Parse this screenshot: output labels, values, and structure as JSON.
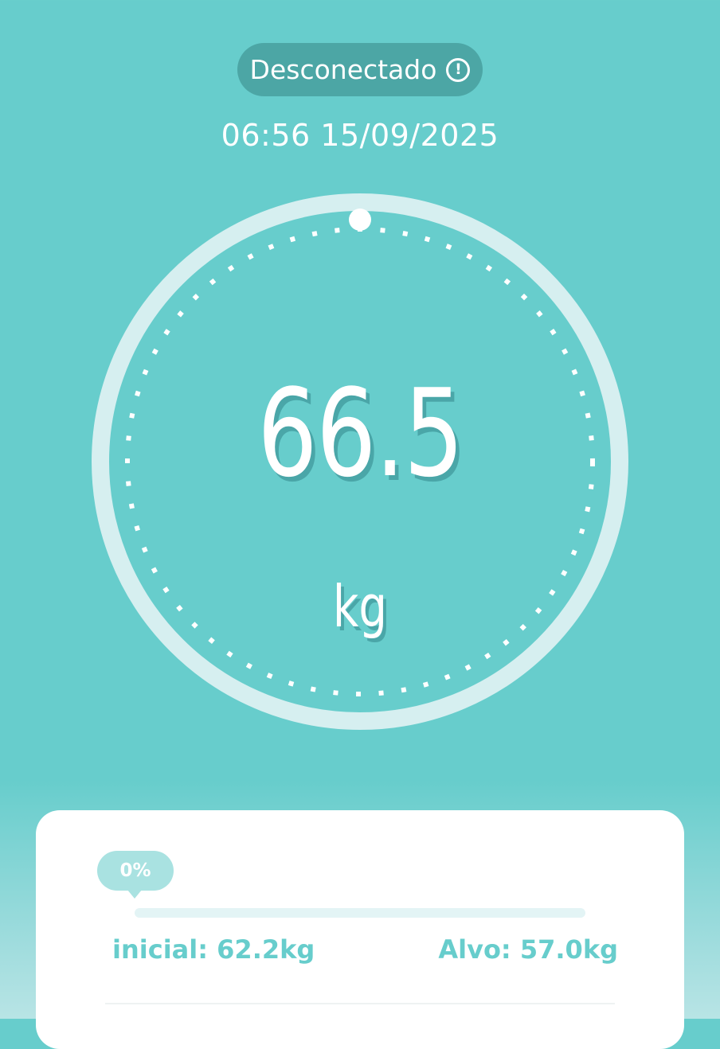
{
  "status": {
    "label": "Desconectado",
    "icon": "alert-circle-icon"
  },
  "measurement": {
    "time": "06:56",
    "date": "15/09/2025",
    "weight": "66.5",
    "unit": "kg"
  },
  "goal": {
    "progress_label": "0%",
    "progress_fraction": 0,
    "start_label": "inicial: 62.2kg",
    "target_label": "Alvo: 57.0kg"
  },
  "colors": {
    "background": "#67cdcc",
    "status_pill": "#4ca6a5",
    "accent": "#67cdcc",
    "badge": "#a9e2e1"
  }
}
